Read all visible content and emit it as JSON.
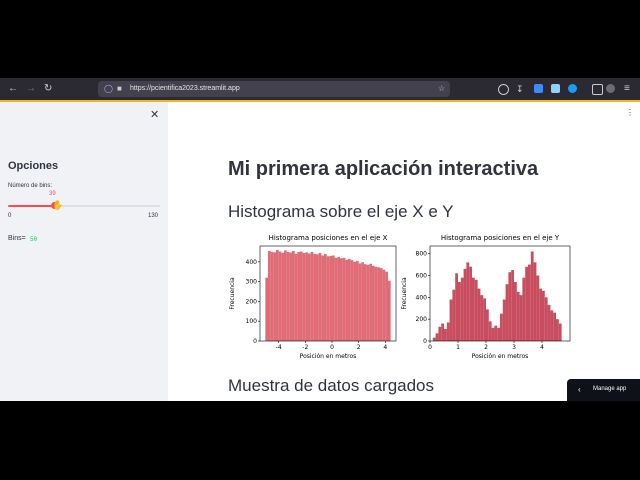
{
  "browser": {
    "url": "https://pcientifica2023.streamlit.app"
  },
  "sidebar": {
    "title": "Opciones",
    "slider_label": "Número de bins:",
    "slider_value": "39",
    "slider_min": "0",
    "slider_max": "130",
    "bins_label": "Bins=",
    "bins_value": "50"
  },
  "main": {
    "title": "Mi primera aplicación interactiva",
    "subheader": "Histograma sobre el eje X e Y",
    "subheader2": "Muestra de datos cargados"
  },
  "manage_app": "Manage app",
  "colors": {
    "slider": "#ff4b4b",
    "hist_x": "#e06c78",
    "hist_y": "#c84d5e",
    "bins_value": "#21c354"
  },
  "chart_data": [
    {
      "type": "bar",
      "title": "Histograma posiciones en el eje X",
      "xlabel": "Posición en metros",
      "ylabel": "Frecuencia",
      "xlim": [
        -5.4,
        4.8
      ],
      "ylim": [
        0,
        480
      ],
      "xticks": [
        "-4",
        "-2",
        "0",
        "2",
        "4"
      ],
      "yticks": [
        "0",
        "100",
        "200",
        "300",
        "400"
      ],
      "bin_start": -5.0,
      "bin_width": 0.2,
      "values": [
        320,
        455,
        450,
        448,
        460,
        452,
        445,
        458,
        450,
        447,
        455,
        440,
        450,
        452,
        445,
        448,
        442,
        450,
        440,
        438,
        445,
        432,
        440,
        428,
        430,
        432,
        420,
        425,
        418,
        420,
        410,
        415,
        408,
        400,
        405,
        392,
        398,
        388,
        385,
        390,
        380,
        375,
        372,
        368,
        360,
        350,
        305
      ]
    },
    {
      "type": "bar",
      "title": "Histograma posiciones en el eje Y",
      "xlabel": "Posición en metros",
      "ylabel": "Frecuencia",
      "xlim": [
        0,
        5
      ],
      "ylim": [
        0,
        870
      ],
      "xticks": [
        "0",
        "1",
        "2",
        "3",
        "4"
      ],
      "yticks": [
        "0",
        "200",
        "400",
        "600",
        "800"
      ],
      "bin_start": 0.1,
      "bin_width": 0.1,
      "values": [
        30,
        70,
        130,
        160,
        110,
        170,
        380,
        470,
        620,
        540,
        580,
        660,
        720,
        680,
        580,
        560,
        480,
        420,
        390,
        290,
        180,
        120,
        140,
        120,
        250,
        380,
        520,
        630,
        650,
        540,
        450,
        420,
        580,
        680,
        700,
        820,
        720,
        600,
        480,
        460,
        400,
        330,
        280,
        260,
        200,
        160
      ]
    }
  ]
}
